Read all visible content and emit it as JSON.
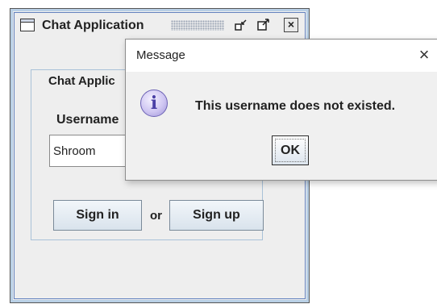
{
  "main_window": {
    "title": "Chat Application",
    "group_title": "Chat Applic",
    "username_label": "Username",
    "username_value": "Shroom",
    "signin_label": "Sign in",
    "or_label": "or",
    "signup_label": "Sign up",
    "close_glyph": "×"
  },
  "dialog": {
    "title": "Message",
    "message": "This username does not existed.",
    "ok_label": "OK",
    "close_glyph": "×",
    "icon_glyph": "i"
  },
  "colors": {
    "window_border": "#b8cfe5",
    "button_top": "#f2f6fa",
    "button_bottom": "#d9e3ec",
    "info_icon": "#9e93d8"
  }
}
